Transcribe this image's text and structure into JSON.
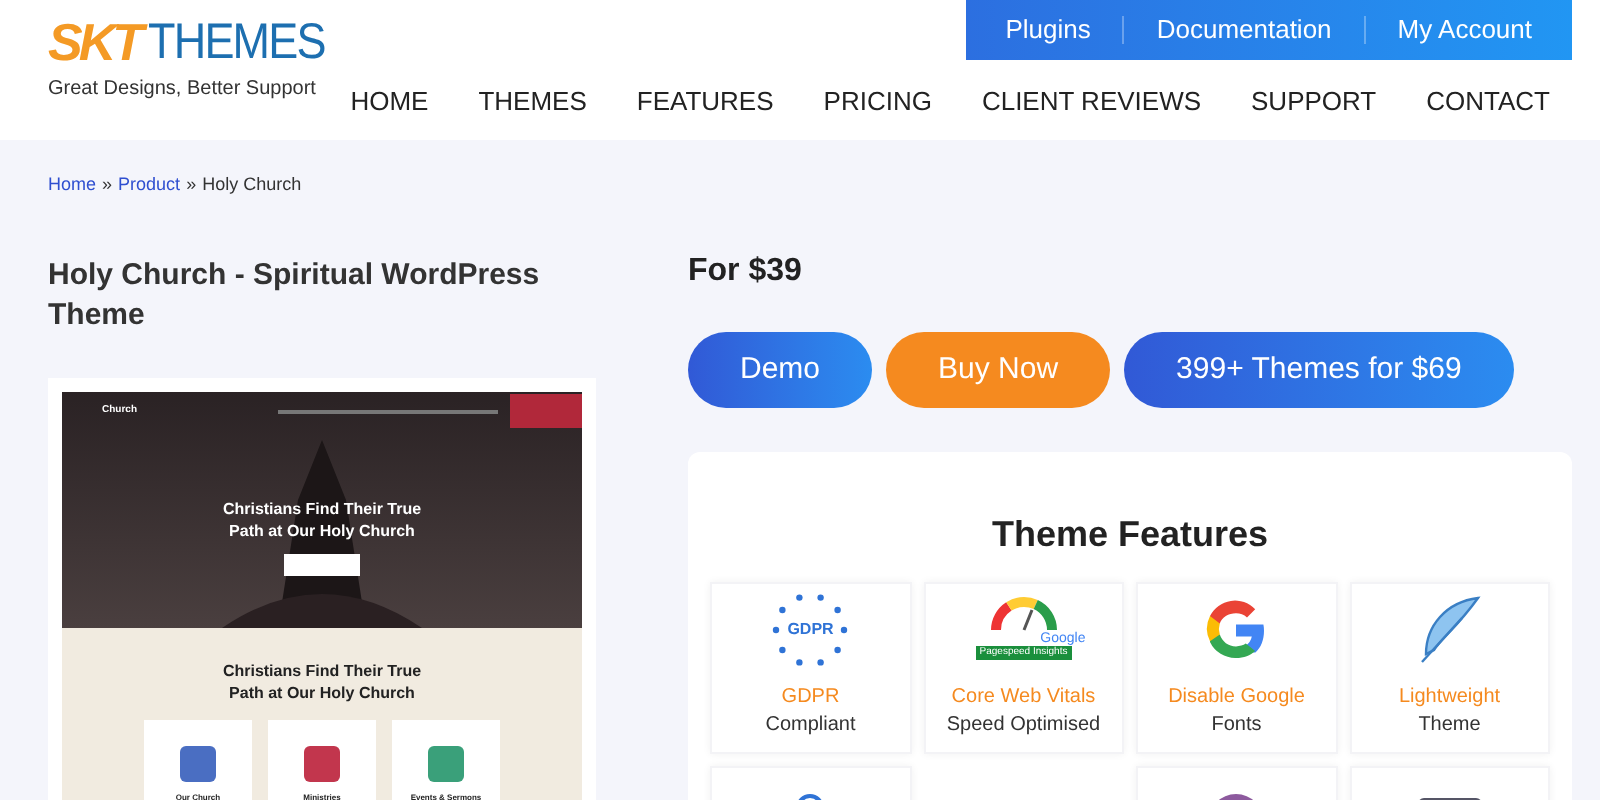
{
  "logo": {
    "mark": "SKT",
    "word": "THEMES",
    "tagline": "Great Designs, Better Support"
  },
  "top_links": [
    "Plugins",
    "Documentation",
    "My Account"
  ],
  "nav": [
    "HOME",
    "THEMES",
    "FEATURES",
    "PRICING",
    "CLIENT REVIEWS",
    "SUPPORT",
    "CONTACT"
  ],
  "breadcrumb": [
    {
      "label": "Home",
      "link": true
    },
    {
      "label": "Product",
      "link": true
    },
    {
      "label": "Holy Church",
      "link": false
    }
  ],
  "breadcrumb_separator": "»",
  "product_title": "Holy Church - Spiritual WordPress Theme",
  "preview": {
    "site_name": "Church",
    "hero_heading": "Christians Find Their True Path at Our Holy Church",
    "section_heading": "Christians Find Their True Path at Our Holy Church",
    "cards": [
      "Our Church",
      "Ministries",
      "Events & Sermons"
    ]
  },
  "price": "For $39",
  "buttons": [
    {
      "label": "Demo",
      "kind": "blue"
    },
    {
      "label": "Buy Now",
      "kind": "orange"
    },
    {
      "label": "399+ Themes for $69",
      "kind": "blue"
    }
  ],
  "features_title": "Theme Features",
  "features": [
    {
      "kind": "gdpr",
      "icon_text": "GDPR",
      "line1": "GDPR",
      "line2": "Compliant"
    },
    {
      "kind": "pagespeed",
      "icon_text": "Google",
      "icon_badge": "Pagespeed Insights",
      "line1": "Core Web Vitals",
      "line2": "Speed Optimised"
    },
    {
      "kind": "google",
      "line1": "Disable Google",
      "line2": "Fonts"
    },
    {
      "kind": "feather",
      "line1": "Lightweight",
      "line2": "Theme"
    },
    {
      "kind": "target"
    },
    {
      "kind": "blank"
    },
    {
      "kind": "circle"
    },
    {
      "kind": "monitor"
    }
  ]
}
